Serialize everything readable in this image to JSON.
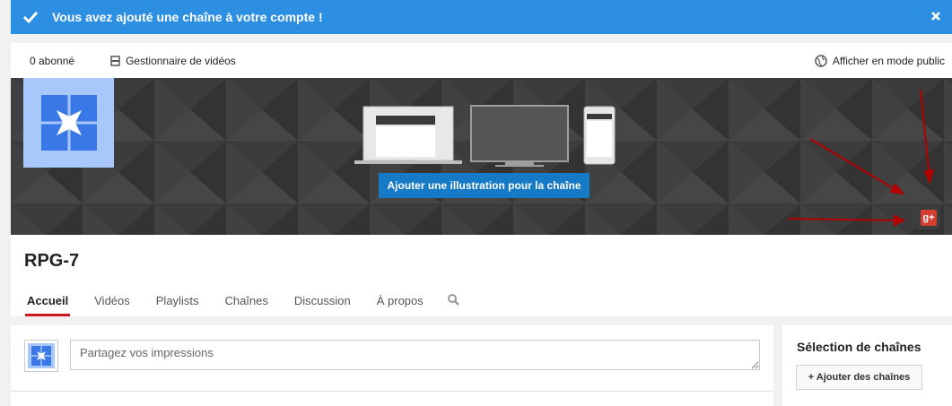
{
  "notification": {
    "message": "Vous avez ajouté une chaîne à votre compte !",
    "color": "#2d8fe2"
  },
  "topbar": {
    "subscribers": "0 abonné",
    "video_manager": "Gestionnaire de vidéos",
    "public_view": "Afficher en mode public"
  },
  "banner": {
    "add_art_label": "Ajouter une illustration pour la chaîne",
    "gplus_label": "g+"
  },
  "channel": {
    "name": "RPG-7",
    "tabs": [
      {
        "label": "Accueil",
        "active": true
      },
      {
        "label": "Vidéos"
      },
      {
        "label": "Playlists"
      },
      {
        "label": "Chaînes"
      },
      {
        "label": "Discussion"
      },
      {
        "label": "À propos"
      }
    ]
  },
  "share": {
    "placeholder": "Partagez vos impressions"
  },
  "sidebar": {
    "title": "Sélection de chaînes",
    "add_button": "+ Ajouter des chaînes"
  },
  "colors": {
    "accent_red": "#cc181e",
    "button_blue": "#167ac6",
    "avatar_blue": "#3b78e7",
    "gplus_red": "#d23f31"
  },
  "icons": [
    "check-icon",
    "close-icon",
    "video-manager-icon",
    "globe-icon",
    "search-icon",
    "google-plus-icon",
    "channel-avatar-icon"
  ]
}
